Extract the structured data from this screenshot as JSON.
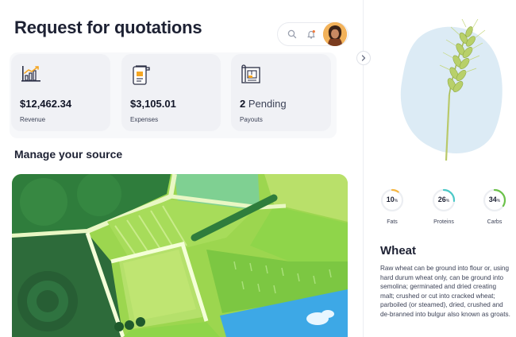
{
  "header": {
    "title": "Request for quotations"
  },
  "icons": {
    "search": "search-icon",
    "notifications": "bell-icon",
    "profile": "avatar"
  },
  "stats": {
    "revenue": {
      "value": "$12,462.34",
      "label": "Revenue",
      "icon": "chart-growth-icon"
    },
    "expenses": {
      "value": "$3,105.01",
      "label": "Expenses",
      "icon": "invoice-icon"
    },
    "payouts": {
      "number": "2",
      "word": "Pending",
      "label": "Payouts",
      "icon": "blueprint-icon"
    }
  },
  "section": {
    "title": "Manage your source"
  },
  "crop": {
    "nutrients": [
      {
        "name": "Fats",
        "percent": 10,
        "label": "10"
      },
      {
        "name": "Proteins",
        "percent": 26,
        "label": "26"
      },
      {
        "name": "Carbs",
        "percent": 34,
        "label": "34"
      }
    ],
    "percent_sign": "%",
    "title": "Wheat",
    "description": "Raw wheat can be ground into flour or, using hard durum wheat only, can be ground into semolina; germinated and dried creating malt; crushed or cut into cracked wheat; parboiled (or steamed), dried, crushed and de-branned into bulgur also known as groats."
  },
  "colors": {
    "accent_ring": "#f6b743",
    "accent_teal": "#4cc9c7",
    "text_dark": "#1d2133",
    "blob": "#dcebf5",
    "field_green": "#6cc24a"
  }
}
